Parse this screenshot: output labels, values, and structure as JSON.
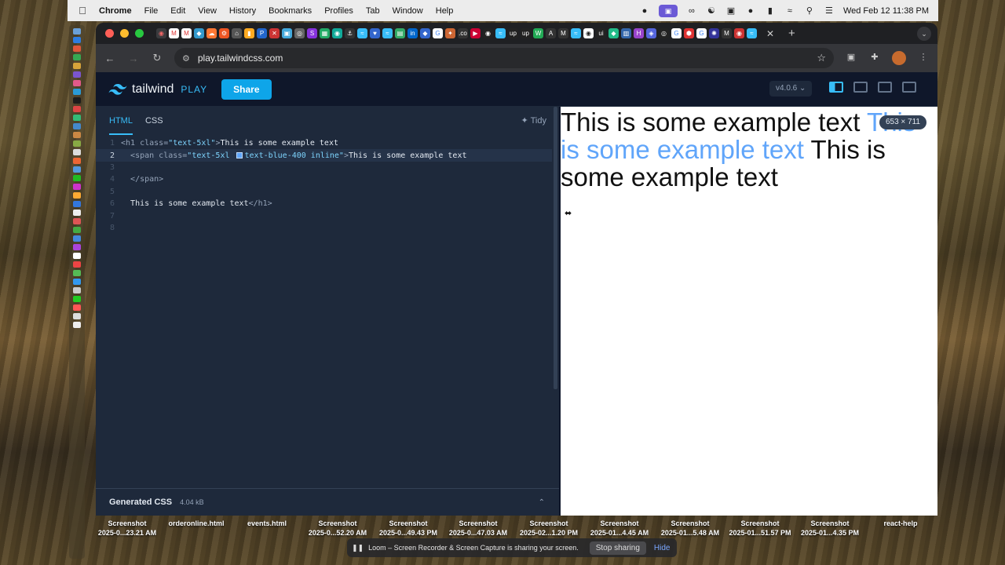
{
  "menubar": {
    "app_name": "Chrome",
    "menus": [
      "File",
      "Edit",
      "View",
      "History",
      "Bookmarks",
      "Profiles",
      "Tab",
      "Window",
      "Help"
    ],
    "clock": "Wed Feb 12  11:38 PM"
  },
  "browser": {
    "url": "play.tailwindcss.com"
  },
  "tailwind_play": {
    "logo_word": "tailwind",
    "logo_play": "PLAY",
    "share_label": "Share",
    "version_label": "v4.0.6 ⌄",
    "editor_tabs": [
      "HTML",
      "CSS"
    ],
    "tidy_label": "Tidy",
    "generated_css_label": "Generated CSS",
    "generated_css_size": "4.04 kB",
    "code_lines": [
      {
        "num": "1"
      },
      {
        "num": "2"
      },
      {
        "num": "3"
      },
      {
        "num": "4"
      },
      {
        "num": "5"
      },
      {
        "num": "6"
      },
      {
        "num": "7"
      },
      {
        "num": "8"
      }
    ],
    "code": {
      "l1_open": "<h1 ",
      "l1_attr": "class=",
      "l1_str": "\"text-5xl\"",
      "l1_close": ">",
      "l1_text": "This is some example text",
      "l2_open": "<span ",
      "l2_attr": "class=",
      "l2_str_a": "\"text-5xl ",
      "l2_str_b": "text-blue-400 inline\"",
      "l2_close": ">",
      "l2_text": "This is some example text",
      "l4_tag": "</span>",
      "l6_text": "This is some example text",
      "l6_tag": "</h1>"
    },
    "preview": {
      "text_a": "This is some example text ",
      "text_blue": "This is some example text",
      "text_b": " This is some example text",
      "size_badge": "653 × 711"
    }
  },
  "desktop_files": [
    {
      "name": "Screenshot",
      "sub": "2025-0...23.21 AM"
    },
    {
      "name": "orderonline.html",
      "sub": ""
    },
    {
      "name": "events.html",
      "sub": ""
    },
    {
      "name": "Screenshot",
      "sub": "2025-0...52.20 AM"
    },
    {
      "name": "Screenshot",
      "sub": "2025-0...49.43 PM"
    },
    {
      "name": "Screenshot",
      "sub": "2025-0...47.03 AM"
    },
    {
      "name": "Screenshot",
      "sub": "2025-02...1.20 PM"
    },
    {
      "name": "Screenshot",
      "sub": "2025-01...4.45 AM"
    },
    {
      "name": "Screenshot",
      "sub": "2025-01...5.48 AM"
    },
    {
      "name": "Screenshot",
      "sub": "2025-01...51.57 PM"
    },
    {
      "name": "Screenshot",
      "sub": "2025-01...4.35 PM"
    },
    {
      "name": "react-help",
      "sub": ""
    }
  ],
  "loom": {
    "message": "Loom – Screen Recorder & Screen Capture is sharing your screen.",
    "stop_label": "Stop sharing",
    "hide_label": "Hide"
  }
}
